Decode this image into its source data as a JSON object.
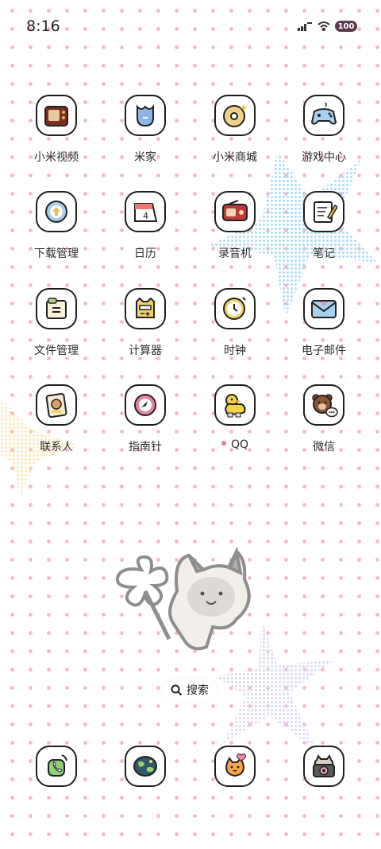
{
  "status_bar": {
    "time": "8:16",
    "battery": "100",
    "icons": [
      "signal-icon",
      "wifi-icon",
      "battery-icon"
    ]
  },
  "apps": [
    {
      "label": "小米视频",
      "icon": "tv-icon"
    },
    {
      "label": "米家",
      "icon": "mijia-icon"
    },
    {
      "label": "小米商城",
      "icon": "donut-icon"
    },
    {
      "label": "游戏中心",
      "icon": "gamepad-icon"
    },
    {
      "label": "下载管理",
      "icon": "download-icon"
    },
    {
      "label": "日历",
      "icon": "calendar-icon"
    },
    {
      "label": "录音机",
      "icon": "radio-icon"
    },
    {
      "label": "笔记",
      "icon": "notes-icon"
    },
    {
      "label": "文件管理",
      "icon": "folder-icon"
    },
    {
      "label": "计算器",
      "icon": "calculator-icon"
    },
    {
      "label": "时钟",
      "icon": "clock-icon"
    },
    {
      "label": "电子邮件",
      "icon": "mail-icon"
    },
    {
      "label": "联系人",
      "icon": "contacts-icon"
    },
    {
      "label": "指南针",
      "icon": "compass-icon"
    },
    {
      "label": "QQ",
      "icon": "qq-duck-icon"
    },
    {
      "label": "微信",
      "icon": "wechat-bear-icon"
    }
  ],
  "search": {
    "label": "搜索",
    "icon": "search-icon"
  },
  "dock": [
    {
      "icon": "phone-icon"
    },
    {
      "icon": "browser-globe-icon"
    },
    {
      "icon": "messages-cat-icon"
    },
    {
      "icon": "camera-icon"
    }
  ],
  "colors": {
    "dot": "#f1b9c7",
    "tile_border": "#1f1f1f",
    "qq_dot": "#e07aa0"
  }
}
